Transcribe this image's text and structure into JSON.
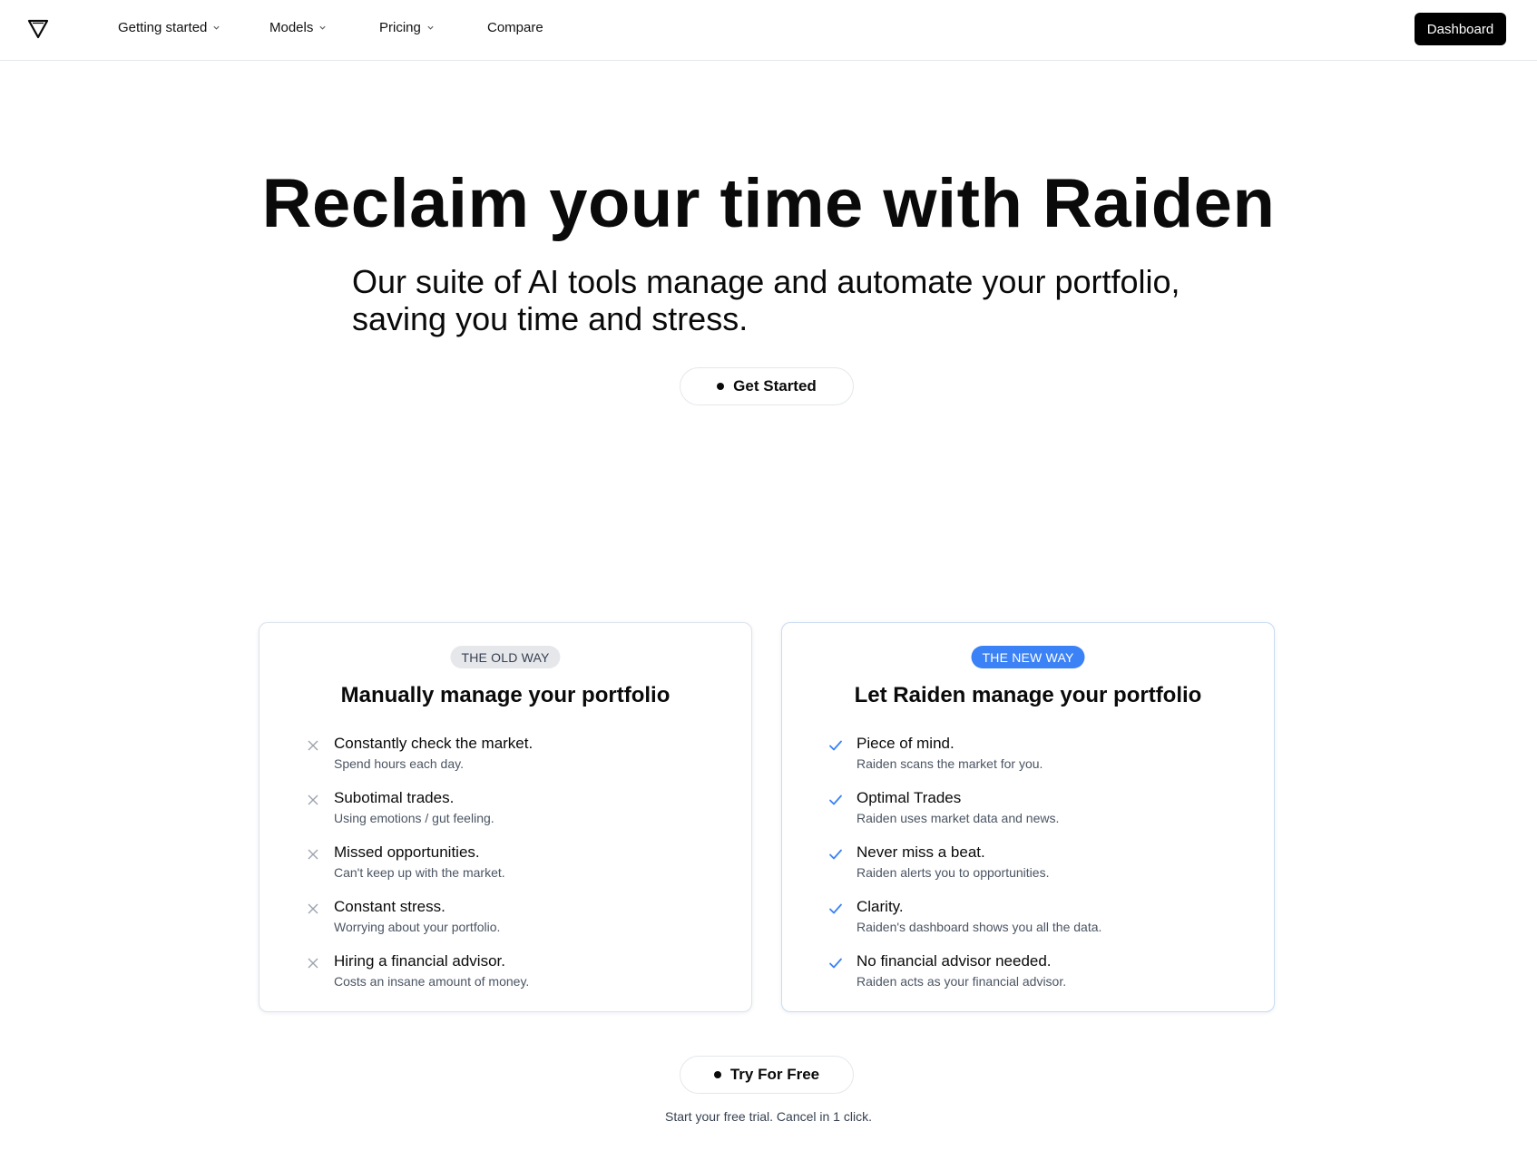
{
  "nav": {
    "logo_icon": "triangle-logo-icon",
    "items": [
      {
        "label": "Getting started",
        "has_dropdown": true
      },
      {
        "label": "Models",
        "has_dropdown": true
      },
      {
        "label": "Pricing",
        "has_dropdown": true
      },
      {
        "label": "Compare",
        "has_dropdown": false
      }
    ],
    "dashboard_label": "Dashboard"
  },
  "hero": {
    "title": "Reclaim your time with Raiden",
    "subtitle_line1": "Our suite of AI tools manage and automate your portfolio,",
    "subtitle_line2": "saving you time and stress.",
    "cta_label": "Get Started"
  },
  "old_way": {
    "badge": "THE OLD WAY",
    "title": "Manually manage your portfolio",
    "icon": "x-icon",
    "items": [
      {
        "title": "Constantly check the market.",
        "sub": "Spend hours each day."
      },
      {
        "title": "Subotimal trades.",
        "sub": "Using emotions / gut feeling."
      },
      {
        "title": "Missed opportunities.",
        "sub": "Can't keep up with the market."
      },
      {
        "title": "Constant stress.",
        "sub": "Worrying about your portfolio."
      },
      {
        "title": "Hiring a financial advisor.",
        "sub": "Costs an insane amount of money."
      }
    ]
  },
  "new_way": {
    "badge": "THE NEW WAY",
    "title": "Let Raiden manage your portfolio",
    "icon": "checkmark-icon",
    "items": [
      {
        "title": "Piece of mind.",
        "sub": "Raiden scans the market for you."
      },
      {
        "title": "Optimal Trades",
        "sub": "Raiden uses market data and news."
      },
      {
        "title": "Never miss a beat.",
        "sub": "Raiden alerts you to opportunities."
      },
      {
        "title": "Clarity.",
        "sub": "Raiden's dashboard shows you all the data."
      },
      {
        "title": "No financial advisor needed.",
        "sub": "Raiden acts as your financial advisor."
      }
    ]
  },
  "footer_cta": {
    "label": "Try For Free",
    "note": "Start your free trial. Cancel in 1 click."
  },
  "colors": {
    "accent_blue": "#3b82f6",
    "badge_gray": "#e5e7eb",
    "x_icon_gray": "#9ca3af",
    "text_dark": "#0a0a0a"
  }
}
